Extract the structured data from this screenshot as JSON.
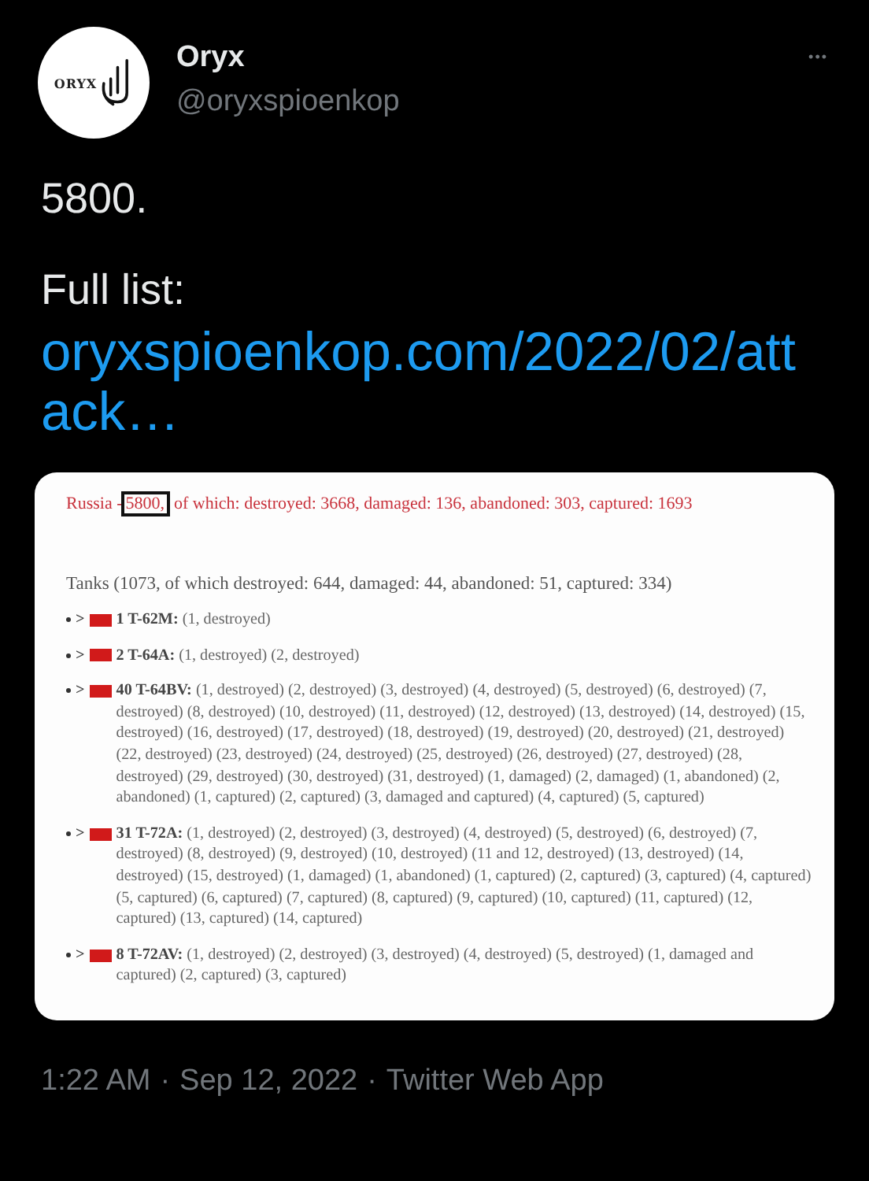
{
  "author": {
    "avatar_text": "ORYX",
    "name": "Oryx",
    "handle": "@oryxspioenkop"
  },
  "more": "•••",
  "body": [
    "5800.",
    "Full list:"
  ],
  "link": "oryxspioenkop.com/2022/02/attack…",
  "attachment": {
    "headline": {
      "before": "Russia -",
      "highlight": "5800,",
      "after": "of which: destroyed: 3668, damaged: 136, abandoned: 303, captured: 1693"
    },
    "section": "Tanks (1073, of which destroyed: 644, damaged: 44, abandoned: 51, captured: 334)",
    "entries": [
      {
        "marker": ">",
        "text": "**1 T-62M:** (1, destroyed)"
      },
      {
        "marker": ">",
        "text": "**2 T-64A:** (1, destroyed) (2, destroyed)"
      },
      {
        "marker": ">",
        "text": "**40 T-64BV:** (1, destroyed) (2, destroyed) (3, destroyed) (4, destroyed) (5, destroyed) (6, destroyed) (7, destroyed) (8, destroyed) (10, destroyed) (11, destroyed) (12, destroyed) (13, destroyed) (14, destroyed) (15, destroyed) (16, destroyed) (17, destroyed) (18, destroyed) (19, destroyed) (20, destroyed) (21, destroyed) (22, destroyed) (23, destroyed) (24, destroyed) (25, destroyed) (26, destroyed) (27, destroyed) (28, destroyed) (29, destroyed) (30, destroyed) (31, destroyed) (1, damaged) (2, damaged) (1, abandoned) (2, abandoned) (1, captured) (2, captured) (3, damaged and captured) (4, captured) (5, captured)"
      },
      {
        "marker": ">",
        "text": "**31 T-72A:** (1, destroyed) (2, destroyed) (3, destroyed) (4, destroyed) (5, destroyed) (6, destroyed) (7, destroyed) (8, destroyed) (9, destroyed) (10, destroyed) (11 and 12, destroyed) (13, destroyed) (14, destroyed) (15, destroyed) (1, damaged) (1, abandoned) (1, captured) (2, captured) (3, captured) (4, captured) (5, captured) (6, captured) (7, captured) (8, captured) (9, captured) (10, captured) (11, captured) (12, captured) (13, captured) (14, captured)"
      },
      {
        "marker": ">",
        "text": "**8 T-72AV:** (1, destroyed) (2, destroyed) (3, destroyed) (4, destroyed) (5, destroyed) (1, damaged and captured) (2, captured) (3, captured)"
      }
    ]
  },
  "footer": [
    "1:22 AM",
    "·",
    "Sep 12, 2022",
    "·",
    "Twitter Web App"
  ]
}
